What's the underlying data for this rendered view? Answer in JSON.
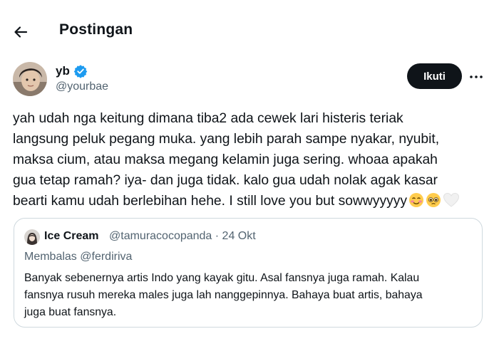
{
  "header": {
    "title": "Postingan"
  },
  "author": {
    "name": "yb",
    "handle": "@yourbae"
  },
  "follow_button": "Ikuti",
  "tweet": {
    "lines": [
      "yah udah nga keitung dimana tiba2 ada cewek lari histeris teriak",
      "langsung peluk pegang muka. yang lebih parah sampe nyakar, nyubit,",
      "maksa cium, atau maksa megang kelamin juga sering. whoaa apakah",
      "gua tetap ramah? iya- dan juga tidak. kalo gua udah nolak agak kasar",
      "bearti kamu udah berlebihan hehe. I still love you but sowwyyyyy"
    ],
    "emojis": [
      "smiling-blushing-face-emoji",
      "pleading-face-emoji",
      "white-heart-emoji"
    ]
  },
  "quote": {
    "name": "Ice Cream",
    "meta": "@tamuracocopanda · 24 Okt",
    "reply_to": "Membalas @ferdiriva",
    "lines": [
      "Banyak sebenernya artis Indo yang kayak gitu. Asal fansnya juga ramah. Kalau",
      "fansnya rusuh mereka males juga lah nanggepinnya. Bahaya buat artis, bahaya",
      "juga buat fansnya."
    ]
  },
  "colors": {
    "text": "#0f1419",
    "muted": "#536471",
    "verified": "#1d9bf0",
    "button": "#0f1419",
    "border": "#cfd9de"
  }
}
